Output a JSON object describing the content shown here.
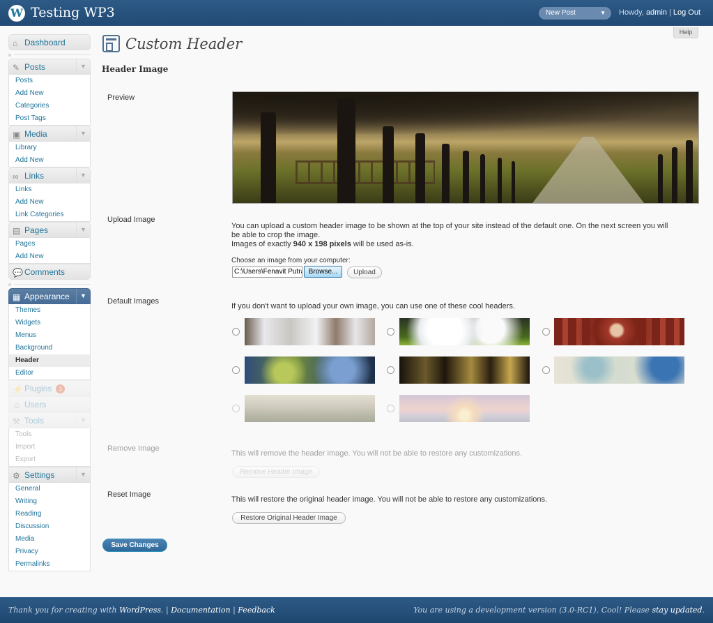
{
  "header": {
    "site_title": "Testing WP3",
    "favorite_action": "New Post",
    "howdy_prefix": "Howdy,",
    "user": "admin",
    "separator": "|",
    "logout": "Log Out"
  },
  "help_label": "Help",
  "menu": {
    "dashboard": "Dashboard",
    "posts": {
      "label": "Posts",
      "items": [
        "Posts",
        "Add New",
        "Categories",
        "Post Tags"
      ]
    },
    "media": {
      "label": "Media",
      "items": [
        "Library",
        "Add New"
      ]
    },
    "links": {
      "label": "Links",
      "items": [
        "Links",
        "Add New",
        "Link Categories"
      ]
    },
    "pages": {
      "label": "Pages",
      "items": [
        "Pages",
        "Add New"
      ]
    },
    "comments": "Comments",
    "appearance": {
      "label": "Appearance",
      "items": [
        "Themes",
        "Widgets",
        "Menus",
        "Background",
        "Header",
        "Editor"
      ]
    },
    "plugins": {
      "label": "Plugins",
      "badge": "1"
    },
    "users": "Users",
    "tools": {
      "label": "Tools",
      "items": [
        "Tools",
        "Import",
        "Export"
      ]
    },
    "settings": {
      "label": "Settings",
      "items": [
        "General",
        "Writing",
        "Reading",
        "Discussion",
        "Media",
        "Privacy",
        "Permalinks"
      ]
    }
  },
  "page": {
    "title": "Custom Header",
    "section": "Header Image",
    "preview_label": "Preview",
    "upload": {
      "label": "Upload Image",
      "desc1": "You can upload a custom header image to be shown at the top of your site instead of the default one. On the next screen you will",
      "desc2": "be able to crop the image.",
      "desc3_prefix": "Images of exactly ",
      "desc3_bold": "940 x 198 pixels",
      "desc3_suffix": " will be used as-is.",
      "choose": "Choose an image from your computer:",
      "file_value": "C:\\Users\\Fenavit Putra",
      "browse": "Browse...",
      "upload_btn": "Upload"
    },
    "defaults": {
      "label": "Default Images",
      "desc": "If you don't want to upload your own image, you can use one of these cool headers."
    },
    "remove": {
      "label": "Remove Image",
      "desc": "This will remove the header image. You will not be able to restore any customizations.",
      "button": "Remove Header Image"
    },
    "reset": {
      "label": "Reset Image",
      "desc": "This will restore the original header image. You will not be able to restore any customizations.",
      "button": "Restore Original Header Image"
    },
    "save": "Save Changes"
  },
  "footer": {
    "thanks_prefix": "Thank you for creating with ",
    "wordpress": "WordPress",
    "thanks_suffix": ".",
    "documentation": "Documentation",
    "feedback": "Feedback",
    "version_prefix": "You are using a development version (3.0-RC1). Cool! Please ",
    "stay_updated": "stay updated",
    "version_suffix": "."
  }
}
